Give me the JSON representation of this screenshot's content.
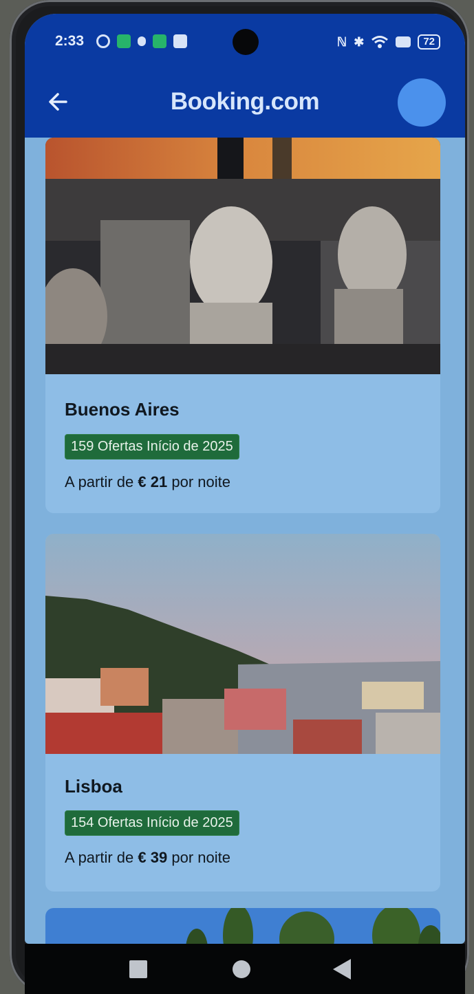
{
  "status_bar": {
    "time": "2:33",
    "battery": "72"
  },
  "app_bar": {
    "brand": "Booking.com"
  },
  "colors": {
    "brand_blue": "#0a3aa2",
    "offer_badge": "#1f6b3b",
    "card_bg": "#8ebde6"
  },
  "cards": [
    {
      "city": "Buenos Aires",
      "offers": "159 Ofertas Início de 2025",
      "price_prefix": "A partir de",
      "price": "€ 21",
      "price_suffix": "por noite"
    },
    {
      "city": "Lisboa",
      "offers": "154 Ofertas Início de 2025",
      "price_prefix": "A partir de",
      "price": "€ 39",
      "price_suffix": "por noite"
    }
  ],
  "icons": [
    "back-arrow-icon",
    "avatar",
    "recents-icon",
    "home-icon",
    "back-icon"
  ]
}
